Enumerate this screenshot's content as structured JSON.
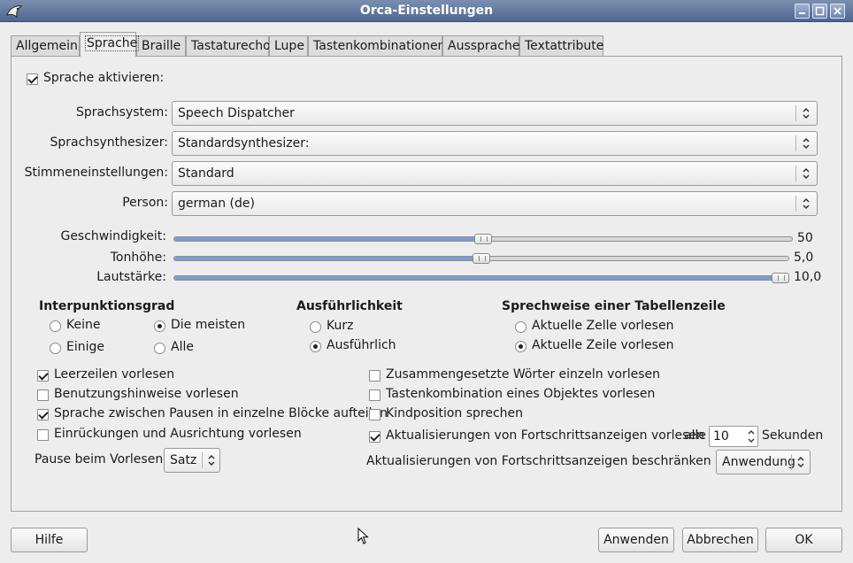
{
  "window": {
    "title": "Orca-Einstellungen"
  },
  "tabs": [
    "Allgemein",
    "Sprache",
    "Braille",
    "Tastaturecho",
    "Lupe",
    "Tastenkombinationen",
    "Aussprache",
    "Textattribute"
  ],
  "active_tab": "Sprache",
  "speech": {
    "enable_label": "Sprache aktivieren:",
    "enable_checked": true,
    "system_label": "Sprachsystem:",
    "system_value": "Speech Dispatcher",
    "synth_label": "Sprachsynthesizer:",
    "synth_value": "Standardsynthesizer:",
    "voice_label": "Stimmeneinstellungen:",
    "voice_value": "Standard",
    "person_label": "Person:",
    "person_value": "german (de)"
  },
  "sliders": {
    "rate": {
      "label": "Geschwindigkeit:",
      "value": "50",
      "fraction": 0.5
    },
    "pitch": {
      "label": "Tonhöhe:",
      "value": "5,0",
      "fraction": 0.5
    },
    "volume": {
      "label": "Lautstärke:",
      "value": "10,0",
      "fraction": 1.0
    }
  },
  "punctuation": {
    "heading": "Interpunktionsgrad",
    "none": "Keine",
    "most": "Die meisten",
    "some": "Einige",
    "all": "Alle",
    "selected": "most"
  },
  "verbosity": {
    "heading": "Ausführlichkeit",
    "brief": "Kurz",
    "verbose": "Ausführlich",
    "selected": "verbose"
  },
  "table_rows": {
    "heading": "Sprechweise einer Tabellenzeile",
    "cell": "Aktuelle Zelle vorlesen",
    "row": "Aktuelle Zeile vorlesen",
    "selected": "row"
  },
  "options": {
    "blank_lines": {
      "label": "Leerzeilen vorlesen",
      "checked": true
    },
    "tutorial": {
      "label": "Benutzungshinweise vorlesen",
      "checked": false
    },
    "chunks": {
      "label": "Sprache zwischen Pausen in einzelne Blöcke aufteilen",
      "checked": true
    },
    "indentation": {
      "label": "Einrückungen und Ausrichtung vorlesen",
      "checked": false
    },
    "mixed_case": {
      "label": "Zusammengesetzte Wörter einzeln vorlesen",
      "checked": false
    },
    "mnemonics": {
      "label": "Tastenkombination eines Objektes vorlesen",
      "checked": false
    },
    "child_position": {
      "label": "Kindposition sprechen",
      "checked": false
    },
    "progress": {
      "label": "Aktualisierungen von Fortschrittsanzeigen vorlesen",
      "checked": true
    }
  },
  "progress": {
    "every_label": "alle",
    "interval": "10",
    "unit": "Sekunden",
    "restrict_label": "Aktualisierungen von Fortschrittsanzeigen beschränken auf:",
    "restrict_value": "Anwendung"
  },
  "pause": {
    "label": "Pause beim Vorlesen:",
    "value": "Satz"
  },
  "buttons": {
    "help": "Hilfe",
    "apply": "Anwenden",
    "cancel": "Abbrechen",
    "ok": "OK"
  }
}
